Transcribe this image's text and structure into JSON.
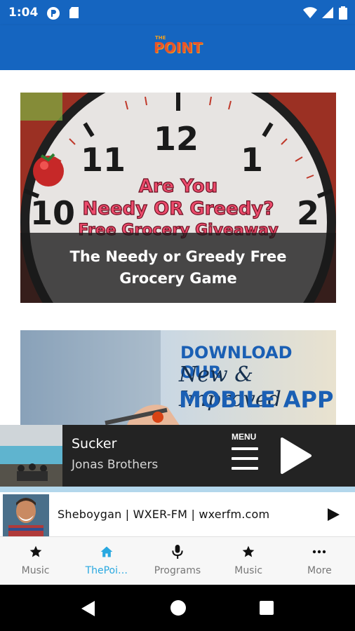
{
  "status_bar": {
    "time": "1:04",
    "icons": [
      "podcast-icon",
      "sd-card-icon",
      "wifi-icon",
      "signal-icon",
      "battery-icon"
    ]
  },
  "app_bar": {
    "logo_small": "THE",
    "logo_main": "POINT"
  },
  "feed": {
    "cards": [
      {
        "title": "The Needy or Greedy Free Grocery Game",
        "image_text": [
          "Are You",
          "Needy OR Greedy?",
          "Free Grocery Giveaway"
        ],
        "clock_numbers": [
          "12",
          "11",
          "1",
          "10",
          "2"
        ]
      },
      {
        "image_text": [
          "DOWNLOAD OUR",
          "New & Improved",
          "MOBILE APP"
        ]
      }
    ]
  },
  "player": {
    "track_title": "Sucker",
    "artist": "Jonas Brothers",
    "menu_label": "MENU"
  },
  "station": {
    "label": "Sheboygan | WXER-FM | wxerfm.com"
  },
  "bottom_nav": {
    "items": [
      {
        "label": "Music",
        "icon": "star-icon",
        "active": false
      },
      {
        "label": "ThePoi…",
        "icon": "home-icon",
        "active": true
      },
      {
        "label": "Programs",
        "icon": "microphone-icon",
        "active": false
      },
      {
        "label": "Music",
        "icon": "star-icon",
        "active": false
      },
      {
        "label": "More",
        "icon": "more-icon",
        "active": false
      }
    ]
  },
  "colors": {
    "app_bar": "#1565c0",
    "active_tab": "#29a8e0",
    "player_bg": "#232323",
    "card_overlay": "#191919"
  }
}
